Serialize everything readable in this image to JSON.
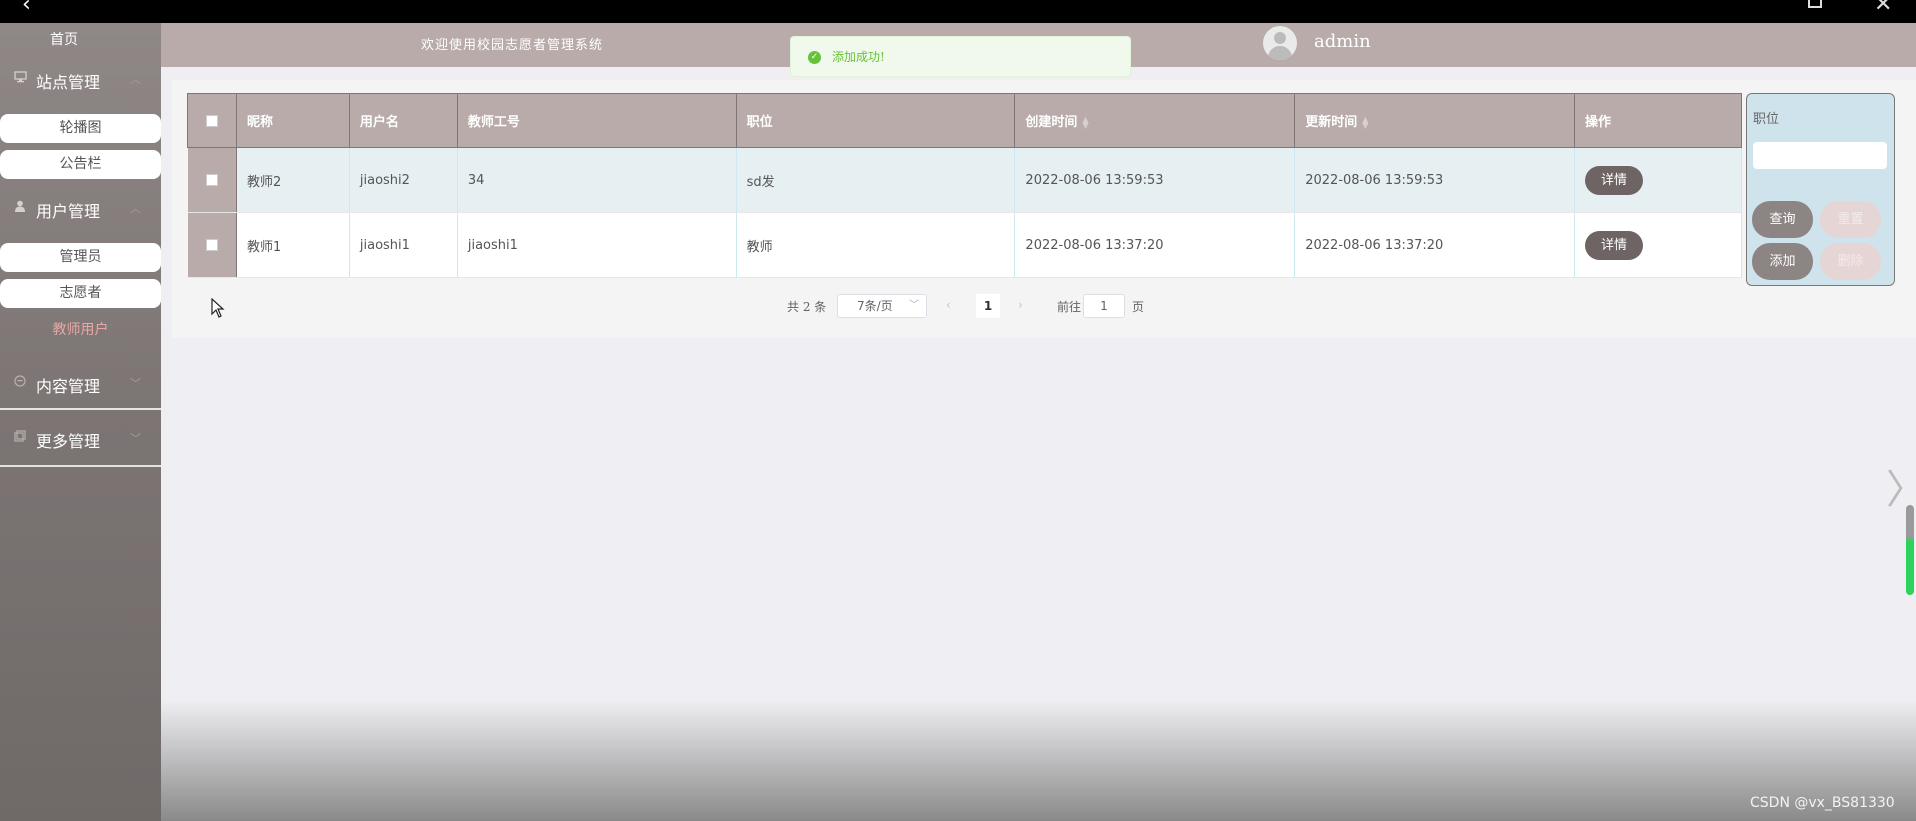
{
  "window": {
    "back_glyph": "‹",
    "close_glyph": "✕"
  },
  "sidebar": {
    "home": "首页",
    "groups": [
      {
        "label": "站点管理",
        "icon": "monitor-icon",
        "chevron": "︿"
      },
      {
        "label": "用户管理",
        "icon": "user-icon",
        "chevron": "︿"
      },
      {
        "label": "内容管理",
        "icon": "chat-icon",
        "chevron": "﹀"
      },
      {
        "label": "更多管理",
        "icon": "copy-icon",
        "chevron": "﹀"
      }
    ],
    "site_items": [
      "轮播图",
      "公告栏"
    ],
    "user_items": [
      "管理员",
      "志愿者",
      "教师用户"
    ],
    "active_item": "教师用户"
  },
  "header": {
    "welcome": "欢迎使用校园志愿者管理系统",
    "username": "admin"
  },
  "toast": {
    "message": "添加成功!",
    "icon": "check-circle-icon",
    "color": "#67c23a"
  },
  "table": {
    "columns": [
      "昵称",
      "用户名",
      "教师工号",
      "职位",
      "创建时间",
      "更新时间",
      "操作"
    ],
    "rows": [
      {
        "nickname": "教师2",
        "username": "jiaoshi2",
        "teacher_id": "34",
        "position": "sd发",
        "created": "2022-08-06 13:59:53",
        "updated": "2022-08-06 13:59:53",
        "action": "详情"
      },
      {
        "nickname": "教师1",
        "username": "jiaoshi1",
        "teacher_id": "jiaoshi1",
        "position": "教师",
        "created": "2022-08-06 13:37:20",
        "updated": "2022-08-06 13:37:20",
        "action": "详情"
      }
    ],
    "sortable_columns": [
      "创建时间",
      "更新时间"
    ]
  },
  "pagination": {
    "total": "共 2 条",
    "page_size": "7条/页",
    "current_page": "1",
    "goto_label": "前往",
    "goto_value": "1",
    "page_unit": "页"
  },
  "search": {
    "label": "职位",
    "input_value": "",
    "buttons": {
      "query": "查询",
      "reset": "重置",
      "add": "添加",
      "delete": "删除"
    }
  },
  "watermark": "CSDN @vx_BS81330",
  "colors": {
    "sidebar": "#7d7675",
    "header": "#b8abaa",
    "accent_active": "#e8a7a4",
    "detail_button": "#6d6463",
    "search_panel": "#cfe3ed"
  }
}
